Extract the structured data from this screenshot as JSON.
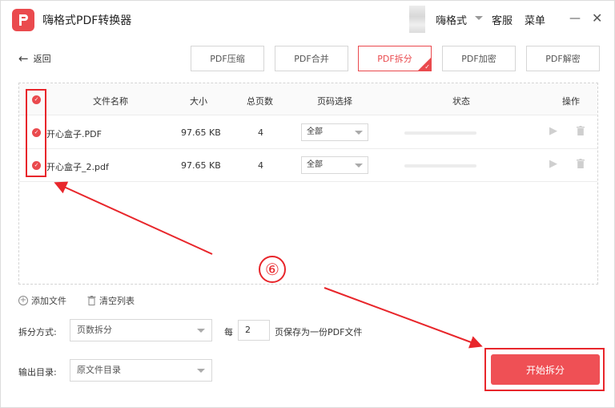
{
  "app": {
    "title": "嗨格式PDF转换器",
    "brand_color": "#ea4a4e",
    "user_name": "嗨格式",
    "service": "客服",
    "menu": "菜单",
    "minimize_icon": "minimize-icon",
    "close_icon": "close-icon"
  },
  "toolbar": {
    "back_label": "返回",
    "tabs": [
      {
        "label": "PDF压缩",
        "active": false
      },
      {
        "label": "PDF合并",
        "active": false
      },
      {
        "label": "PDF拆分",
        "active": true
      },
      {
        "label": "PDF加密",
        "active": false
      },
      {
        "label": "PDF解密",
        "active": false
      }
    ]
  },
  "table": {
    "headers": {
      "name": "文件名称",
      "size": "大小",
      "pages": "总页数",
      "page_select": "页码选择",
      "status": "状态",
      "actions": "操作"
    },
    "rows": [
      {
        "name": "开心盒子.PDF",
        "size": "97.65 KB",
        "pages": "4",
        "page_select": "全部",
        "checked": true
      },
      {
        "name": "开心盒子_2.pdf",
        "size": "97.65 KB",
        "pages": "4",
        "page_select": "全部",
        "checked": true
      }
    ]
  },
  "actions": {
    "add_file": "添加文件",
    "clear_list": "清空列表"
  },
  "split": {
    "mode_label": "拆分方式:",
    "mode_value": "页数拆分",
    "per_label": "每",
    "per_value": "2",
    "per_suffix": "页保存为一份PDF文件"
  },
  "output": {
    "label": "输出目录:",
    "value": "原文件目录"
  },
  "start_button": "开始拆分",
  "annotation": {
    "step_number": "⑥",
    "color": "#e8262b"
  }
}
